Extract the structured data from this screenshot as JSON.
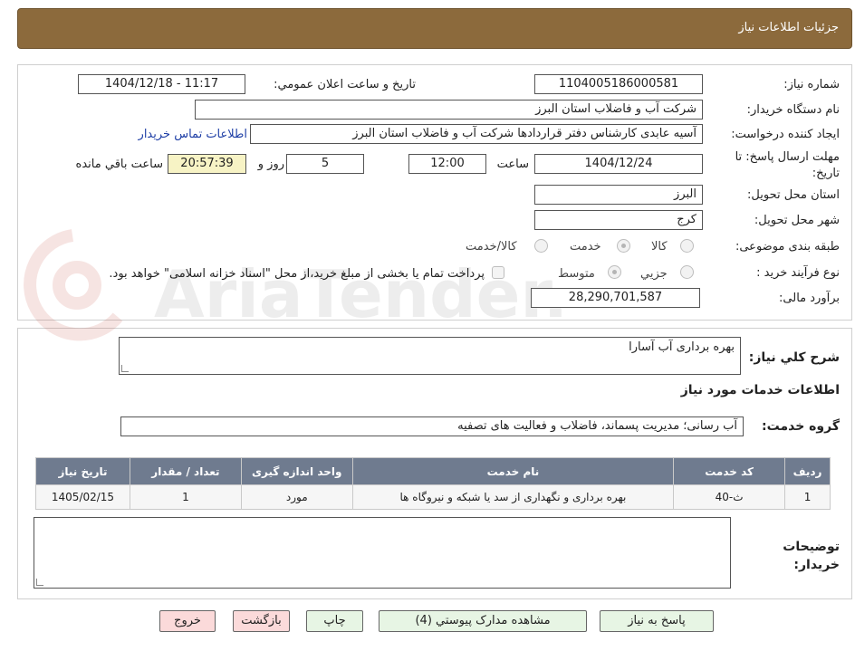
{
  "header": {
    "title": "جزئیات اطلاعات نیاز"
  },
  "fields": {
    "need_number_label": "شماره نیاز:",
    "need_number": "1104005186000581",
    "announce_label": "تاریخ و ساعت اعلان عمومي:",
    "announce_value": "1404/12/18 - 11:17",
    "buyer_org_label": "نام دستگاه خریدار:",
    "buyer_org": "شرکت آب و فاضلاب استان البرز",
    "requester_label": "ایجاد کننده درخواست:",
    "requester": "آسیه عابدی کارشناس دفتر قراردادها شرکت آب و فاضلاب استان البرز",
    "contact_link": "اطلاعات تماس خریدار",
    "deadline_label": "مهلت ارسال پاسخ: تا تاریخ:",
    "deadline_date": "1404/12/24",
    "time_label": "ساعت",
    "deadline_time": "12:00",
    "days_value": "5",
    "days_label": "روز و",
    "remaining_time": "20:57:39",
    "remaining_label": "ساعت باقي مانده",
    "province_label": "استان محل تحویل:",
    "province": "البرز",
    "city_label": "شهر محل تحویل:",
    "city": "کرج",
    "category_label": "طبقه بندی موضوعی:",
    "category_options": [
      "کالا",
      "خدمت",
      "کالا/خدمت"
    ],
    "process_label": "نوع فرآیند خرید :",
    "process_options": [
      "جزیي",
      "متوسط"
    ],
    "payment_note": "پرداخت تمام یا بخشی از مبلغ خرید،از محل \"اسناد خزانه اسلامی\" خواهد بود.",
    "budget_label": "برآورد مالی:",
    "budget": "28,290,701,587"
  },
  "summary": {
    "label": "شرح کلي نیاز:",
    "value": "بهره برداری آب آسارا"
  },
  "services": {
    "section_title": "اطلاعات خدمات مورد نیاز",
    "group_label": "گروه خدمت:",
    "group_value": "آب رسانی؛ مدیریت پسماند، فاضلاب و فعالیت های تصفیه",
    "columns": [
      "ردیف",
      "کد خدمت",
      "نام خدمت",
      "واحد اندازه گیری",
      "تعداد / مقدار",
      "تاریخ نیاز"
    ],
    "rows": [
      [
        "1",
        "ث-40",
        "بهره برداری و نگهداری از سد یا شبکه و نیروگاه ها",
        "مورد",
        "1",
        "1405/02/15"
      ]
    ]
  },
  "buyer_notes": {
    "label": "توضیحات خریدار:",
    "value": ""
  },
  "buttons": {
    "reply": "پاسخ به نیاز",
    "attachments": "مشاهده مدارک پیوستي (4)",
    "print": "چاپ",
    "back": "بازگشت",
    "exit": "خروج"
  },
  "watermark_text": "AriaTender.neT",
  "colors": {
    "header_bg": "#8c6a3c",
    "table_header_bg": "#6f7b8f",
    "time_bg": "#f7f3c5",
    "link": "#1f3fa6",
    "button_bg": "#e7f5e4",
    "button_red_bg": "#fbdada"
  }
}
